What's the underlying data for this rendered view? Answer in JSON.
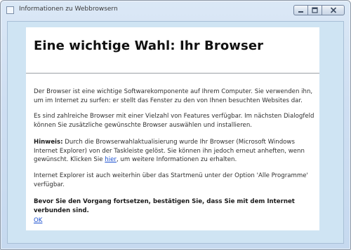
{
  "window": {
    "title": "Informationen zu Webbrowsern",
    "buttons": {
      "minimize_icon": "minimize-icon",
      "maximize_icon": "maximize-icon",
      "close_icon": "close-icon"
    }
  },
  "content": {
    "heading": "Eine wichtige Wahl: Ihr Browser",
    "paragraph1": "Der Browser ist eine wichtige Softwarekomponente auf Ihrem Computer. Sie verwenden ihn, um im Internet zu surfen: er stellt das Fenster zu den von Ihnen besuchten Websites dar.",
    "paragraph2": "Es sind zahlreiche Browser mit einer Vielzahl von Features verfügbar. Im nächsten Dialogfeld können Sie zusätzliche gewünschte Browser auswählen und installieren.",
    "paragraph3": {
      "lead": "Hinweis:",
      "text_before_link": " Durch die Browserwahlaktualisierung wurde Ihr Browser (Microsoft Windows Internet Explorer) von der Taskleiste gelöst. Sie können ihn jedoch erneut anheften, wenn gewünscht. Klicken Sie ",
      "link": "hier",
      "text_after_link": ", um weitere Informationen zu erhalten."
    },
    "paragraph4": "Internet Explorer ist auch weiterhin über das Startmenü unter der Option 'Alle Programme' verfügbar.",
    "paragraph5": "Bevor Sie den Vorgang fortsetzen, bestätigen Sie, dass Sie mit dem Internet verbunden sind.",
    "ok_link": "OK"
  },
  "colors": {
    "client_background": "#cfe4f3",
    "link": "#1a4fd0"
  }
}
